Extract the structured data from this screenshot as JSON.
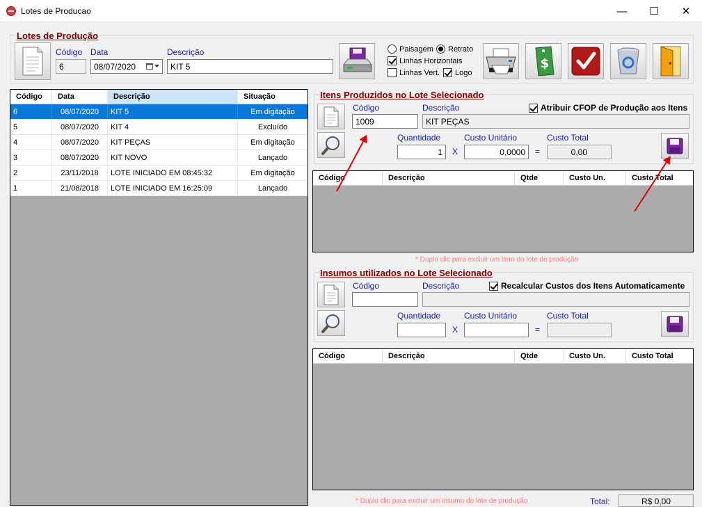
{
  "window": {
    "title": "Lotes de Producao",
    "minimize": "—",
    "maximize": "☐",
    "close": "✕"
  },
  "lote": {
    "group_title": "Lotes de Produção",
    "codigo_label": "Código",
    "codigo_value": "6",
    "data_label": "Data",
    "data_value": "08/07/2020",
    "descricao_label": "Descrição",
    "descricao_value": "KIT 5"
  },
  "print_options": {
    "paisagem": "Paisagem",
    "retrato": "Retrato",
    "linhas_horizontais": "Linhas Horizontais",
    "linhas_vert": "Linhas Vert.",
    "logo": "Logo"
  },
  "lotes_grid": {
    "headers": [
      "Código",
      "Data",
      "Descrição",
      "Situação"
    ],
    "rows": [
      [
        "6",
        "08/07/2020",
        "KIT 5",
        "Em digitação"
      ],
      [
        "5",
        "08/07/2020",
        "KIT 4",
        "Excluído"
      ],
      [
        "4",
        "08/07/2020",
        "KIT PEÇAS",
        "Em digitação"
      ],
      [
        "3",
        "08/07/2020",
        "KIT NOVO",
        "Lançado"
      ],
      [
        "2",
        "23/11/2018",
        "LOTE INICIADO EM 08:45:32",
        "Em digitação"
      ],
      [
        "1",
        "21/08/2018",
        "LOTE INICIADO EM 16:25:09",
        "Lançado"
      ]
    ]
  },
  "itens": {
    "group_title": "Itens Produzidos no Lote Selecionado",
    "codigo_label": "Código",
    "codigo_value": "1009",
    "descricao_label": "Descrição",
    "descricao_value": "KIT PEÇAS",
    "cfop_label": "Atribuir CFOP de Produção aos Itens",
    "quantidade_label": "Quantidade",
    "quantidade_value": "1",
    "custo_unit_label": "Custo Unitário",
    "custo_unit_value": "0,0000",
    "custo_total_label": "Custo Total",
    "custo_total_value": "0,00",
    "x_sign": "X",
    "eq_sign": "=",
    "grid_headers": [
      "Código",
      "Descrição",
      "Qtde",
      "Custo Un.",
      "Custo Total"
    ],
    "hint": "* Duplo clic para excluir um item do lote de produção"
  },
  "insumos": {
    "group_title": "Insumos utilizados no Lote Selecionado",
    "codigo_label": "Código",
    "codigo_value": "",
    "descricao_label": "Descrição",
    "descricao_value": "",
    "recalc_label": "Recalcular Custos dos Itens Automaticamente",
    "quantidade_label": "Quantidade",
    "quantidade_value": "",
    "custo_unit_label": "Custo Unitário",
    "custo_unit_value": "",
    "custo_total_label": "Custo Total",
    "custo_total_value": "",
    "x_sign": "X",
    "eq_sign": "=",
    "grid_headers": [
      "Código",
      "Descrição",
      "Qtde",
      "Custo Un.",
      "Custo Total"
    ],
    "hint": "* Duplo clic para excluir um insumo do lote de produção",
    "total_label": "Total:",
    "total_value": "R$ 0,00"
  },
  "colors": {
    "group_title": "#800000",
    "label": "#1a1aa8",
    "selection": "#0a78d7",
    "grid_empty": "#ababab",
    "annotation_arrow": "#e00000"
  }
}
